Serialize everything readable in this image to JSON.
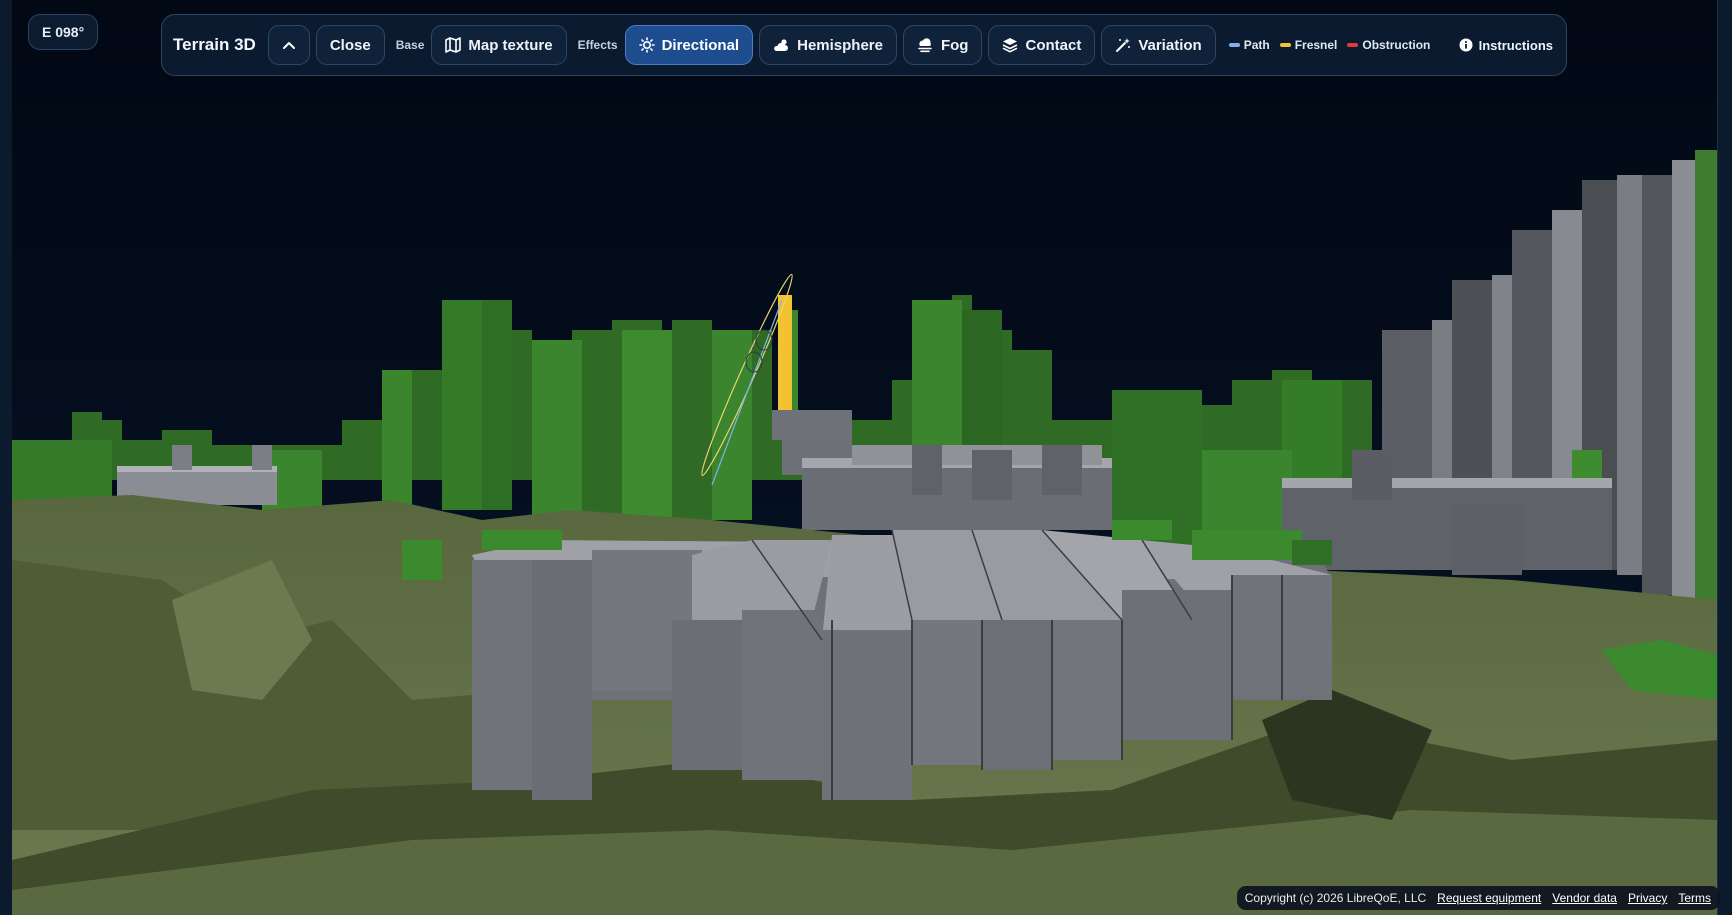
{
  "compass": {
    "label": "E 098°"
  },
  "toolbar": {
    "title": "Terrain 3D",
    "close_label": "Close",
    "base_label": "Base",
    "map_texture_label": "Map texture",
    "effects_label": "Effects",
    "effects": [
      {
        "label": "Directional",
        "icon": "sun-icon",
        "active": true
      },
      {
        "label": "Hemisphere",
        "icon": "cloud-sun-icon",
        "active": false
      },
      {
        "label": "Fog",
        "icon": "fog-icon",
        "active": false
      },
      {
        "label": "Contact",
        "icon": "layers-icon",
        "active": false
      },
      {
        "label": "Variation",
        "icon": "magic-wand-icon",
        "active": false
      }
    ],
    "legend": [
      {
        "label": "Path",
        "color": "#7fb2ea"
      },
      {
        "label": "Fresnel",
        "color": "#f2c230"
      },
      {
        "label": "Obstruction",
        "color": "#e23b3b"
      }
    ],
    "instructions_label": "Instructions"
  },
  "footer": {
    "copyright": "Copyright (c) 2026 LibreQoE, LLC",
    "links": [
      "Request equipment",
      "Vendor data",
      "Privacy",
      "Terms"
    ]
  },
  "colors": {
    "sky": "#020a17",
    "terrain": "#5e6f43",
    "trees": "#3a7a2c",
    "buildings": "#6e7178",
    "building_top": "#9ea0a6",
    "active_button": "#1d4d8f"
  }
}
